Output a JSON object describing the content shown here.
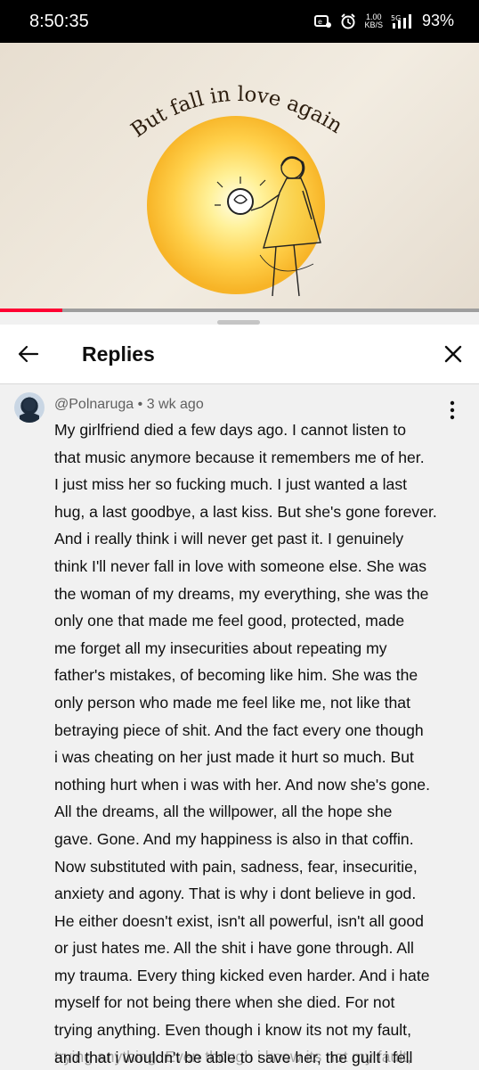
{
  "status_bar": {
    "time": "8:50:35",
    "net_speed_value": "1.00",
    "net_speed_unit": "KB/S",
    "network": "5G",
    "battery": "93%"
  },
  "video": {
    "lyric_text": "But fall in love again",
    "progress_fraction": 0.13
  },
  "replies_panel": {
    "title": "Replies",
    "comment": {
      "author": "@Polnaruga",
      "separator": " • ",
      "age": "3 wk ago",
      "text": "My girlfriend died a few days ago. I cannot listen to\nthat music anymore because it remembers me of her.\nI just miss her so fucking much. I just wanted a last\nhug, a last goodbye, a last kiss. But she's gone forever.\nAnd i really think i will never get past it. I genuinely\nthink I'll never fall in love with someone else. She was\nthe woman of my dreams, my everything, she was the\nonly one that made me feel good, protected, made\nme forget all my insecurities about repeating my\nfather's mistakes, of becoming like him. She was the\nonly person who made me feel like me, not like that\nbetraying piece of shit. And the fact every one though\ni was cheating on her just made it hurt so much. But\nnothing hurt when i was with her. And now she's gone.\nAll the dreams, all the willpower, all the hope she\ngave. Gone. And my happiness is also in that coffin.\nNow substituted with pain, sadness, fear, insecuritie,\nanxiety and agony. That is why i dont believe in god.\nHe either doesn't exist, isn't all powerful, isn't all good\nor just hates me. All the shit i have gone through. All\nmy trauma. Every thing kicked even harder. And i hate\nmyself for not being there when she died. For not\ntrying anything. Even though i know its not my fault,\nand that i wouldn't be able to save her, the guilt i fell\nwill never go away",
      "ghost_text": "trying anything. Even though i know its not my fault,"
    }
  }
}
